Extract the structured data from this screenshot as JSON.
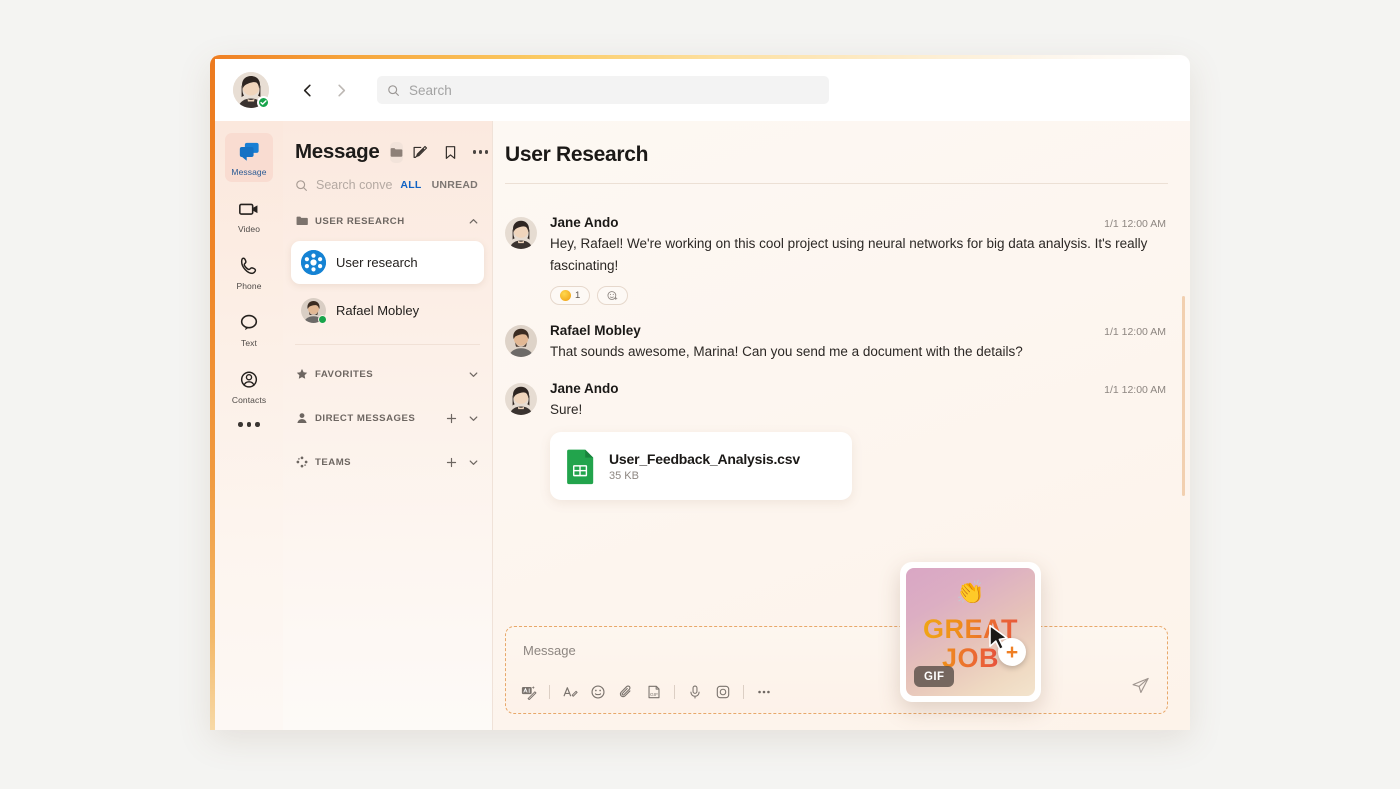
{
  "topbar": {
    "avatar_name": "user-avatar",
    "presence_status": "available",
    "back_label": "Back",
    "forward_label": "Forward",
    "search_placeholder": "Search",
    "search_value": ""
  },
  "rail": {
    "items": [
      {
        "label": "Message",
        "icon": "message-icon",
        "active": true
      },
      {
        "label": "Video",
        "icon": "video-icon",
        "active": false
      },
      {
        "label": "Phone",
        "icon": "phone-icon",
        "active": false
      },
      {
        "label": "Text",
        "icon": "text-icon",
        "active": false
      },
      {
        "label": "Contacts",
        "icon": "contacts-icon",
        "active": false
      }
    ],
    "more_label": "More"
  },
  "conversations": {
    "title": "Message",
    "folder_icon": "folder-icon",
    "actions": [
      {
        "name": "compose-button",
        "icon": "compose-icon"
      },
      {
        "name": "bookmark-button",
        "icon": "bookmark-icon"
      },
      {
        "name": "more-button",
        "icon": "more-icon"
      }
    ],
    "search_placeholder": "Search convers...",
    "search_value": "",
    "filters": [
      {
        "label": "ALL",
        "active": true
      },
      {
        "label": "UNREAD",
        "active": false
      }
    ],
    "sections": [
      {
        "label": "USER RESEARCH",
        "icon": "folder-icon",
        "expanded": true,
        "has_add": false,
        "chevron": "chevron-up-icon",
        "items": [
          {
            "name": "User research",
            "type": "channel",
            "selected": true
          },
          {
            "name": "Rafael Mobley",
            "type": "person",
            "selected": false,
            "presence": "available"
          }
        ]
      },
      {
        "label": "FAVORITES",
        "icon": "star-icon",
        "expanded": false,
        "has_add": false,
        "chevron": "chevron-down-icon",
        "items": []
      },
      {
        "label": "DIRECT MESSAGES",
        "icon": "person-icon",
        "expanded": false,
        "has_add": true,
        "chevron": "chevron-down-icon",
        "items": []
      },
      {
        "label": "TEAMS",
        "icon": "teams-icon",
        "expanded": false,
        "has_add": true,
        "chevron": "chevron-down-icon",
        "items": []
      }
    ]
  },
  "thread": {
    "title": "User Research",
    "messages": [
      {
        "author": "Jane Ando",
        "time": "1/1 12:00 AM",
        "text": "Hey, Rafael! We're working on this cool project using neural networks for big data analysis. It's really fascinating!",
        "avatar": "jane-avatar",
        "reactions": [
          {
            "emoji": "smile-emoji",
            "count": "1"
          }
        ],
        "add_reaction_label": "Add reaction",
        "attachment": null
      },
      {
        "author": "Rafael Mobley",
        "time": "1/1 12:00 AM",
        "text": "That sounds awesome, Marina! Can you send me a document with the details?",
        "avatar": "rafael-avatar",
        "reactions": [],
        "attachment": null
      },
      {
        "author": "Jane Ando",
        "time": "1/1 12:00 AM",
        "text": "Sure!",
        "avatar": "jane-avatar",
        "reactions": [],
        "attachment": {
          "file_name": "User_Feedback_Analysis.csv",
          "file_size": "35 KB",
          "icon": "spreadsheet-icon"
        }
      }
    ]
  },
  "composer": {
    "placeholder": "Message",
    "value": "",
    "tools": [
      {
        "name": "ai-translate-button",
        "icon": "ai-translate-icon"
      },
      {
        "name": "format-button",
        "icon": "format-text-icon"
      },
      {
        "name": "emoji-button",
        "icon": "emoji-icon"
      },
      {
        "name": "attach-button",
        "icon": "paperclip-icon"
      },
      {
        "name": "gif-button",
        "icon": "gif-icon"
      },
      {
        "name": "audio-button",
        "icon": "microphone-icon"
      },
      {
        "name": "screenshot-button",
        "icon": "camera-icon"
      },
      {
        "name": "more-tools-button",
        "icon": "more-icon"
      }
    ],
    "send_label": "Send",
    "send_icon": "send-icon"
  },
  "gif_overlay": {
    "line1": "GREAT",
    "line2": "JOB",
    "emoji": "clapping-hands",
    "badge": "GIF",
    "add_label": "+",
    "cursor": "cursor-pointer"
  },
  "colors": {
    "accent_orange": "#ef7f24",
    "accent_blue": "#1062c4",
    "channel_blue": "#1583d4",
    "presence_green": "#17a44b",
    "file_green": "#22a44c",
    "page_bg": "#f4f4f2"
  }
}
